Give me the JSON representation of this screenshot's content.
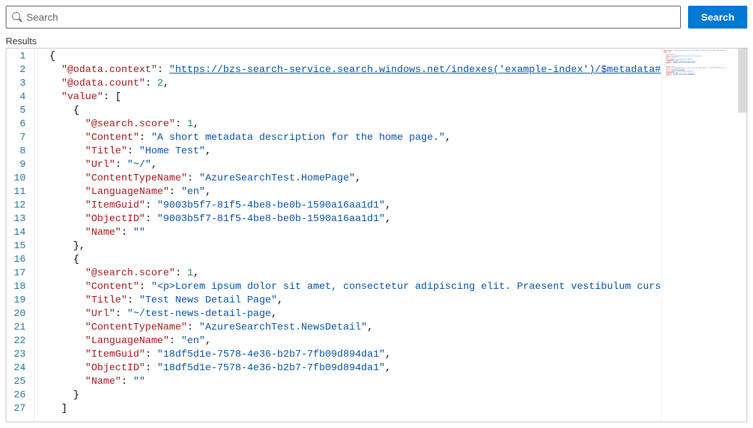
{
  "search": {
    "placeholder": "Search",
    "button_label": "Search"
  },
  "results_label": "Results",
  "gutter_lines": [
    "1",
    "2",
    "3",
    "4",
    "5",
    "6",
    "7",
    "8",
    "9",
    "10",
    "11",
    "12",
    "13",
    "14",
    "15",
    "16",
    "17",
    "18",
    "19",
    "20",
    "21",
    "22",
    "23",
    "24",
    "25",
    "26",
    "27"
  ],
  "json_content": {
    "odata_context_key": "@odata.context",
    "odata_context_value": "https://bzs-search-service.search.windows.net/indexes('example-index')/$metadata#docs(*",
    "odata_count_key": "@odata.count",
    "odata_count_value": 2,
    "value_key": "value",
    "items": [
      {
        "search_score_key": "@search.score",
        "search_score": 1,
        "content_key": "Content",
        "content": "A short metadata description for the home page.",
        "title_key": "Title",
        "title": "Home Test",
        "url_key": "Url",
        "url": "~/",
        "ctn_key": "ContentTypeName",
        "ctn": "AzureSearchTest.HomePage",
        "lang_key": "LanguageName",
        "lang": "en",
        "guid_key": "ItemGuid",
        "guid": "9003b5f7-81f5-4be8-be0b-1590a16aa1d1",
        "oid_key": "ObjectID",
        "oid": "9003b5f7-81f5-4be8-be0b-1590a16aa1d1",
        "name_key": "Name",
        "name": ""
      },
      {
        "search_score_key": "@search.score",
        "search_score": 1,
        "content_key": "Content",
        "content": "<p>Lorem ipsum dolor sit amet, consectetur adipiscing elit. Praesent vestibulum cursus tri",
        "title_key": "Title",
        "title": "Test News Detail Page",
        "url_key": "Url",
        "url": "~/test-news-detail-page",
        "ctn_key": "ContentTypeName",
        "ctn": "AzureSearchTest.NewsDetail",
        "lang_key": "LanguageName",
        "lang": "en",
        "guid_key": "ItemGuid",
        "guid": "18df5d1e-7578-4e36-b2b7-7fb09d894da1",
        "oid_key": "ObjectID",
        "oid": "18df5d1e-7578-4e36-b2b7-7fb09d894da1",
        "name_key": "Name",
        "name": ""
      }
    ]
  }
}
